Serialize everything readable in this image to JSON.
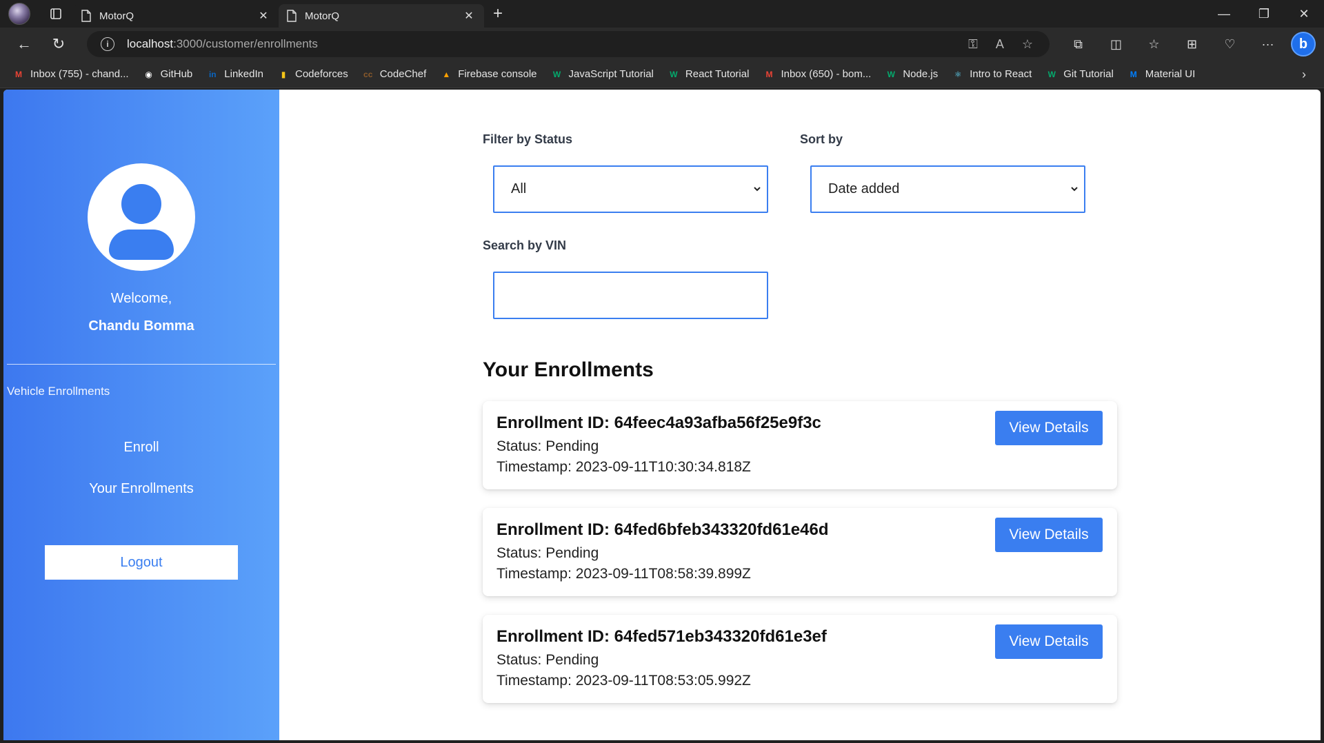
{
  "browser": {
    "tabs": [
      {
        "title": "MotorQ",
        "active": false
      },
      {
        "title": "MotorQ",
        "active": true
      }
    ],
    "url_host": "localhost",
    "url_path": ":3000/customer/enrollments",
    "bookmarks": [
      {
        "label": "Inbox (755) - chand...",
        "icon": "gmail-icon",
        "color": "#ea4335"
      },
      {
        "label": "GitHub",
        "icon": "github-icon",
        "color": "#ffffff"
      },
      {
        "label": "LinkedIn",
        "icon": "linkedin-icon",
        "color": "#0a66c2"
      },
      {
        "label": "Codeforces",
        "icon": "codeforces-icon",
        "color": "#f5c518"
      },
      {
        "label": "CodeChef",
        "icon": "codechef-icon",
        "color": "#8b5a2b"
      },
      {
        "label": "Firebase console",
        "icon": "firebase-icon",
        "color": "#ffa000"
      },
      {
        "label": "JavaScript Tutorial",
        "icon": "w3schools-icon",
        "color": "#04aa6d"
      },
      {
        "label": "React Tutorial",
        "icon": "w3schools-icon",
        "color": "#04aa6d"
      },
      {
        "label": "Inbox (650) - bom...",
        "icon": "gmail-icon",
        "color": "#ea4335"
      },
      {
        "label": "Node.js",
        "icon": "w3schools-icon",
        "color": "#04aa6d"
      },
      {
        "label": "Intro to React",
        "icon": "react-icon",
        "color": "#61dafb"
      },
      {
        "label": "Git Tutorial",
        "icon": "w3schools-icon",
        "color": "#04aa6d"
      },
      {
        "label": "Material UI",
        "icon": "mui-icon",
        "color": "#007fff"
      }
    ]
  },
  "sidebar": {
    "welcome": "Welcome,",
    "username": "Chandu Bomma",
    "section_label": "Vehicle Enrollments",
    "links": [
      {
        "label": "Enroll"
      },
      {
        "label": "Your Enrollments"
      }
    ],
    "logout_label": "Logout"
  },
  "filters": {
    "status_label": "Filter by Status",
    "status_value": "All",
    "sort_label": "Sort by",
    "sort_value": "Date added",
    "search_label": "Search by VIN",
    "search_value": ""
  },
  "enrollments": {
    "heading": "Your Enrollments",
    "view_label": "View Details",
    "items": [
      {
        "id": "Enrollment ID: 64feec4a93afba56f25e9f3c",
        "status": "Status: Pending",
        "timestamp": "Timestamp: 2023-09-11T10:30:34.818Z"
      },
      {
        "id": "Enrollment ID: 64fed6bfeb343320fd61e46d",
        "status": "Status: Pending",
        "timestamp": "Timestamp: 2023-09-11T08:58:39.899Z"
      },
      {
        "id": "Enrollment ID: 64fed571eb343320fd61e3ef",
        "status": "Status: Pending",
        "timestamp": "Timestamp: 2023-09-11T08:53:05.992Z"
      }
    ]
  },
  "colors": {
    "accent": "#3a7ef0",
    "sidebar_start": "#3d78ef",
    "sidebar_end": "#5ba1fa"
  }
}
